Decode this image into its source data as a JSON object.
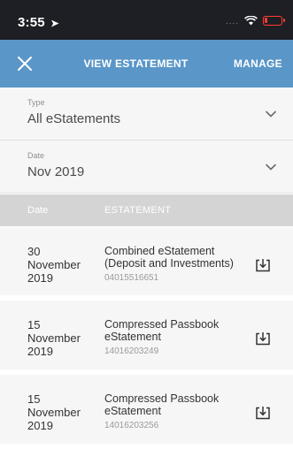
{
  "status_bar": {
    "time": "3:55",
    "location_icon": "location-arrow-icon",
    "signal": "....",
    "wifi_icon": "wifi-icon",
    "battery_icon": "battery-low-icon",
    "battery_level_percent": 15,
    "battery_color": "#ff3b30"
  },
  "nav": {
    "title": "VIEW ESTATEMENT",
    "manage_label": "MANAGE",
    "close_icon": "close-icon",
    "background": "#5a96c8"
  },
  "filters": {
    "type": {
      "label": "Type",
      "value": "All eStatements"
    },
    "date": {
      "label": "Date",
      "value": "Nov 2019"
    }
  },
  "table": {
    "headers": {
      "date": "Date",
      "estatement": "ESTATEMENT"
    },
    "rows": [
      {
        "date_day": "30",
        "date_month": "November",
        "date_year": "2019",
        "title_line1": "Combined eStatement",
        "title_line2": "(Deposit and Investments)",
        "number": "04015516651"
      },
      {
        "date_day": "15",
        "date_month": "November",
        "date_year": "2019",
        "title_line1": "Compressed Passbook",
        "title_line2": "eStatement",
        "number": "14016203249"
      },
      {
        "date_day": "15",
        "date_month": "November",
        "date_year": "2019",
        "title_line1": "Compressed Passbook",
        "title_line2": "eStatement",
        "number": "14016203256"
      }
    ],
    "download_icon": "download-icon"
  }
}
